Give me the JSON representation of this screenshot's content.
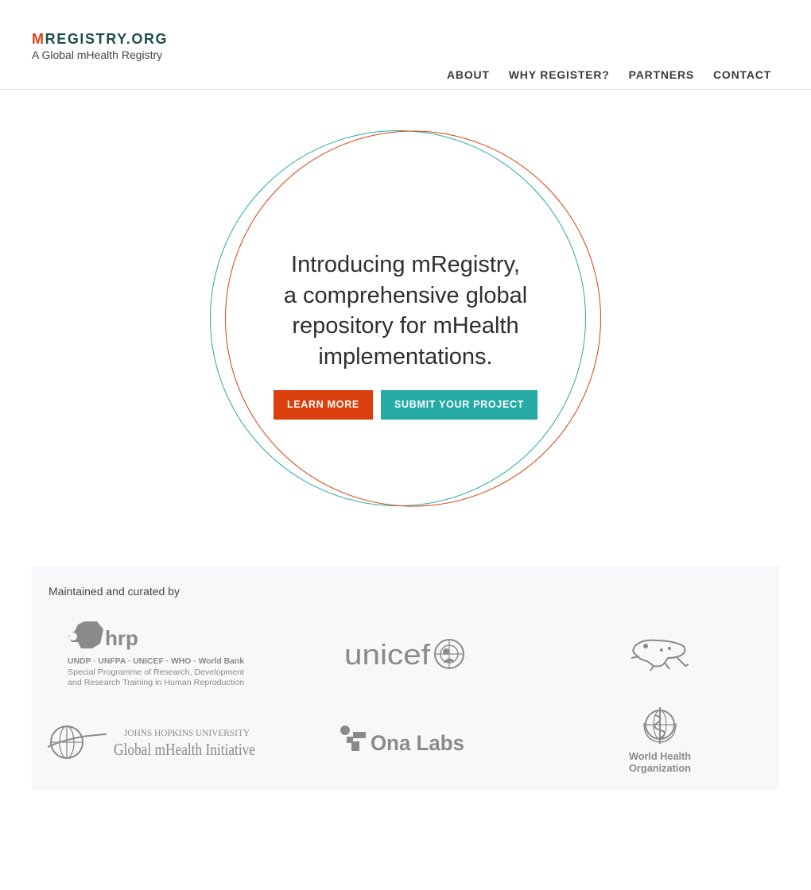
{
  "brand": {
    "initial": "M",
    "rest": "REGISTRY.ORG",
    "tagline": "A Global mHealth Registry"
  },
  "nav": [
    {
      "label": "ABOUT"
    },
    {
      "label": "WHY REGISTER?"
    },
    {
      "label": "PARTNERS"
    },
    {
      "label": "CONTACT"
    }
  ],
  "hero": {
    "lines": [
      "Introducing mRegistry,",
      "a comprehensive global",
      "repository for mHealth",
      "implementations."
    ],
    "learn_more": "LEARN MORE",
    "submit": "SUBMIT YOUR PROJECT"
  },
  "partners": {
    "title": "Maintained and curated by",
    "hrp": {
      "name": "hrp",
      "line1": "UNDP · UNFPA · UNICEF · WHO · World Bank",
      "line2": "Special Programme of Research, Development",
      "line3": "and Research Training in Human Reproduction"
    },
    "unicef": {
      "name": "unicef"
    },
    "jhu": {
      "line1": "JOHNS HOPKINS UNIVERSITY",
      "line2": "Global mHealth Initiative"
    },
    "ona": {
      "name": "Ona Labs"
    },
    "who": {
      "line1": "World Health",
      "line2": "Organization"
    }
  },
  "colors": {
    "accent_orange": "#dc3f0e",
    "accent_teal": "#26aaa5",
    "brand_dark": "#1f4f4a",
    "logo_gray": "#8a8a8a"
  },
  "icons": [
    "frog-icon",
    "globe-icon",
    "who-emblem-icon",
    "ona-blocks-icon",
    "unicef-emblem-icon",
    "hrp-blob-icon"
  ]
}
